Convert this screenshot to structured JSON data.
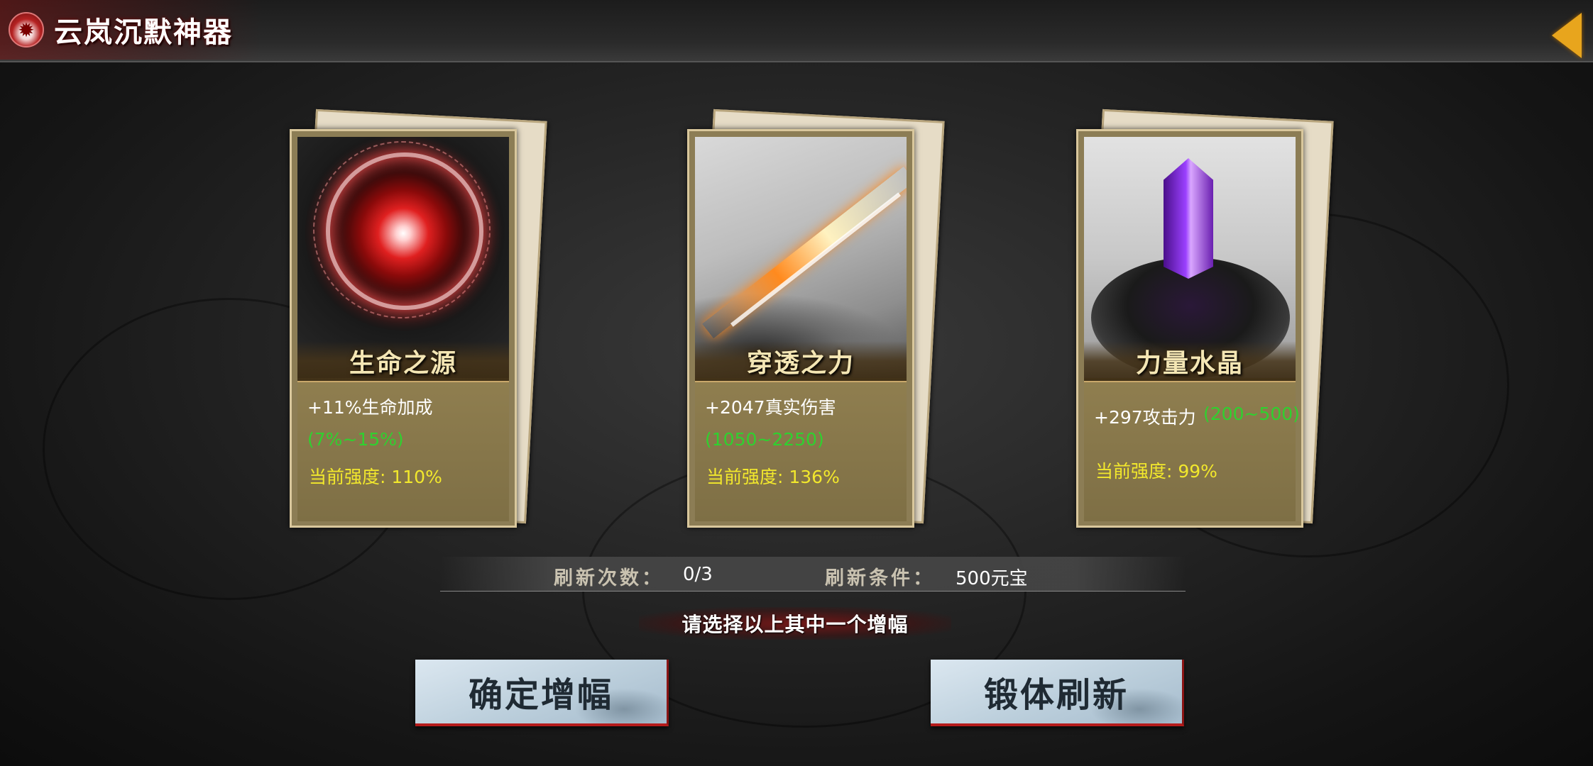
{
  "header": {
    "title": "云岚沉默神器",
    "back_icon": "chevron-left-icon",
    "emblem_icon": "flame-emblem-icon"
  },
  "cards": [
    {
      "name": "生命之源",
      "stat": "+11%生命加成",
      "range": "(7%~15%)",
      "strength": "当前强度: 110%"
    },
    {
      "name": "穿透之力",
      "stat": "+2047真实伤害",
      "range": "(1050~2250)",
      "strength": "当前强度: 136%"
    },
    {
      "name": "力量水晶",
      "stat": "+297攻击力",
      "range": "(200~500)",
      "strength": "当前强度: 99%"
    }
  ],
  "refresh": {
    "count_label": "刷新次数：",
    "count_value": "0/3",
    "cost_label": "刷新条件：",
    "cost_value": "500元宝"
  },
  "prompt": "请选择以上其中一个增幅",
  "buttons": {
    "confirm": "确定增幅",
    "reforge": "锻体刷新"
  },
  "colors": {
    "range_green": "#2fd12f",
    "strength_yellow": "#f2e82c",
    "back_orange": "#e8a51d",
    "button_border_red": "#b51b1b"
  }
}
